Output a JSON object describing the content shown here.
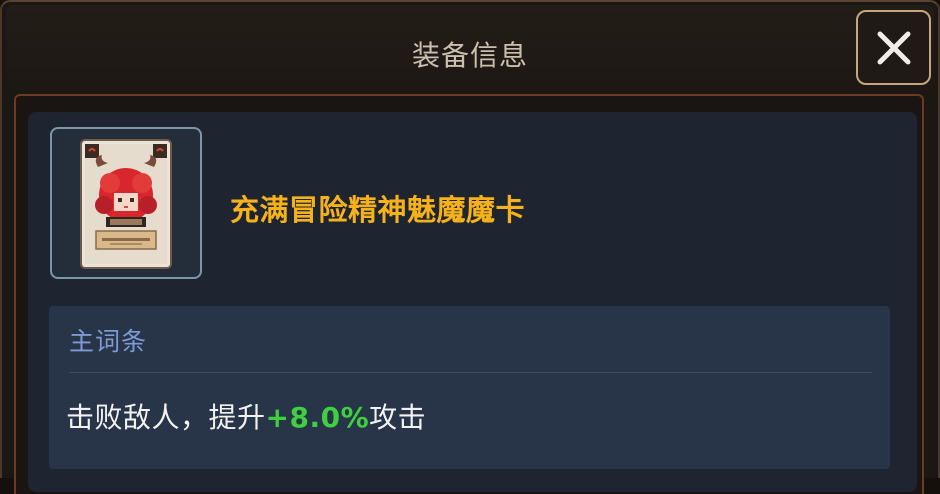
{
  "dialog": {
    "title": "装备信息",
    "close_icon": "close-icon"
  },
  "item": {
    "name": "充满冒险精神魅魔魔卡",
    "name_color": "#f6b21a",
    "icon": "succubus-card-icon"
  },
  "main_affix": {
    "header": "主词条",
    "text_before": "击败敌人，提升",
    "bonus": "+8.0%",
    "text_after": "攻击",
    "bonus_color": "#3fd03f"
  }
}
